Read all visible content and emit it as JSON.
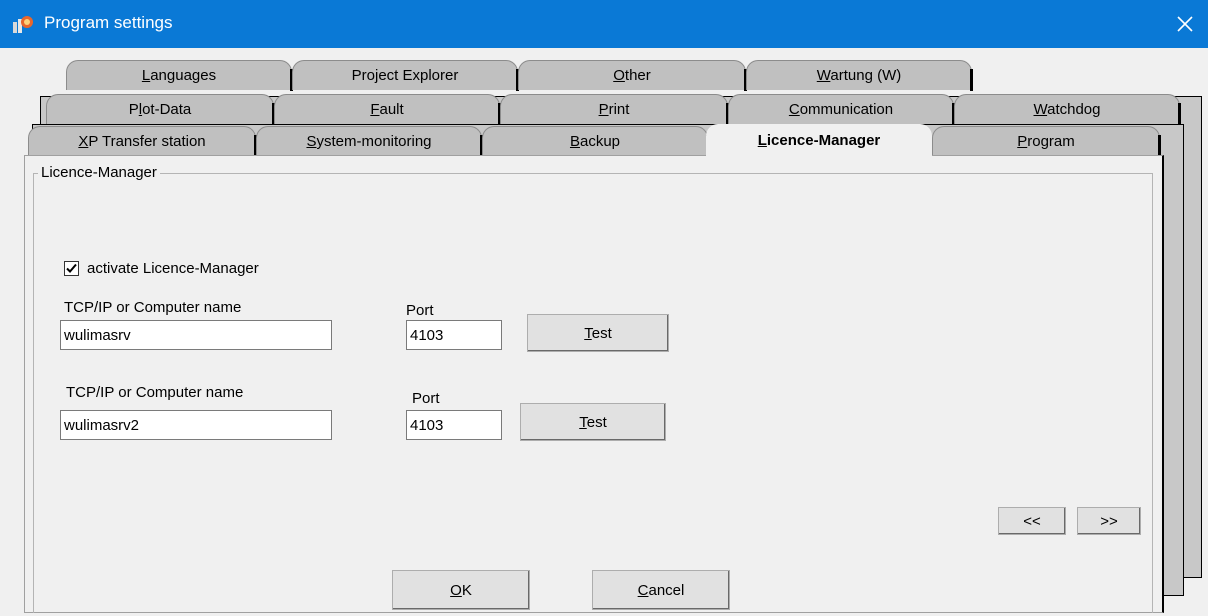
{
  "window": {
    "title": "Program settings"
  },
  "tabs": {
    "row1": [
      {
        "label": "Languages",
        "mnemonic": "L"
      },
      {
        "label": "Project Explorer",
        "mnemonic": ""
      },
      {
        "label": "Other",
        "mnemonic": "O"
      },
      {
        "label": "Wartung (W)",
        "mnemonic": "W"
      }
    ],
    "row2": [
      {
        "label": "Plot-Data",
        "mnemonic": "l"
      },
      {
        "label": "Fault",
        "mnemonic": "F"
      },
      {
        "label": "Print",
        "mnemonic": "P"
      },
      {
        "label": "Communication",
        "mnemonic": "C"
      },
      {
        "label": "Watchdog",
        "mnemonic": "W"
      }
    ],
    "row3": [
      {
        "label": "XP Transfer station",
        "mnemonic": "X"
      },
      {
        "label": "System-monitoring",
        "mnemonic": "S"
      },
      {
        "label": "Backup",
        "mnemonic": "B"
      },
      {
        "label": "Licence-Manager",
        "mnemonic": "L",
        "active": true
      },
      {
        "label": "Program",
        "mnemonic": "P"
      }
    ]
  },
  "group": {
    "title": "Licence-Manager"
  },
  "checkbox": {
    "label": "activate Licence-Manager",
    "checked": true
  },
  "server1": {
    "host_label": "TCP/IP or Computer name",
    "host_value": "wulimasrv",
    "port_label": "Port",
    "port_value": "4103",
    "test_label": "Test"
  },
  "server2": {
    "host_label": "TCP/IP or Computer name",
    "host_value": "wulimasrv2",
    "port_label": "Port",
    "port_value": "4103",
    "test_label": "Test"
  },
  "nav": {
    "prev_label": "<<",
    "next_label": ">>"
  },
  "footer": {
    "ok_label": "OK",
    "cancel_label": "Cancel"
  }
}
